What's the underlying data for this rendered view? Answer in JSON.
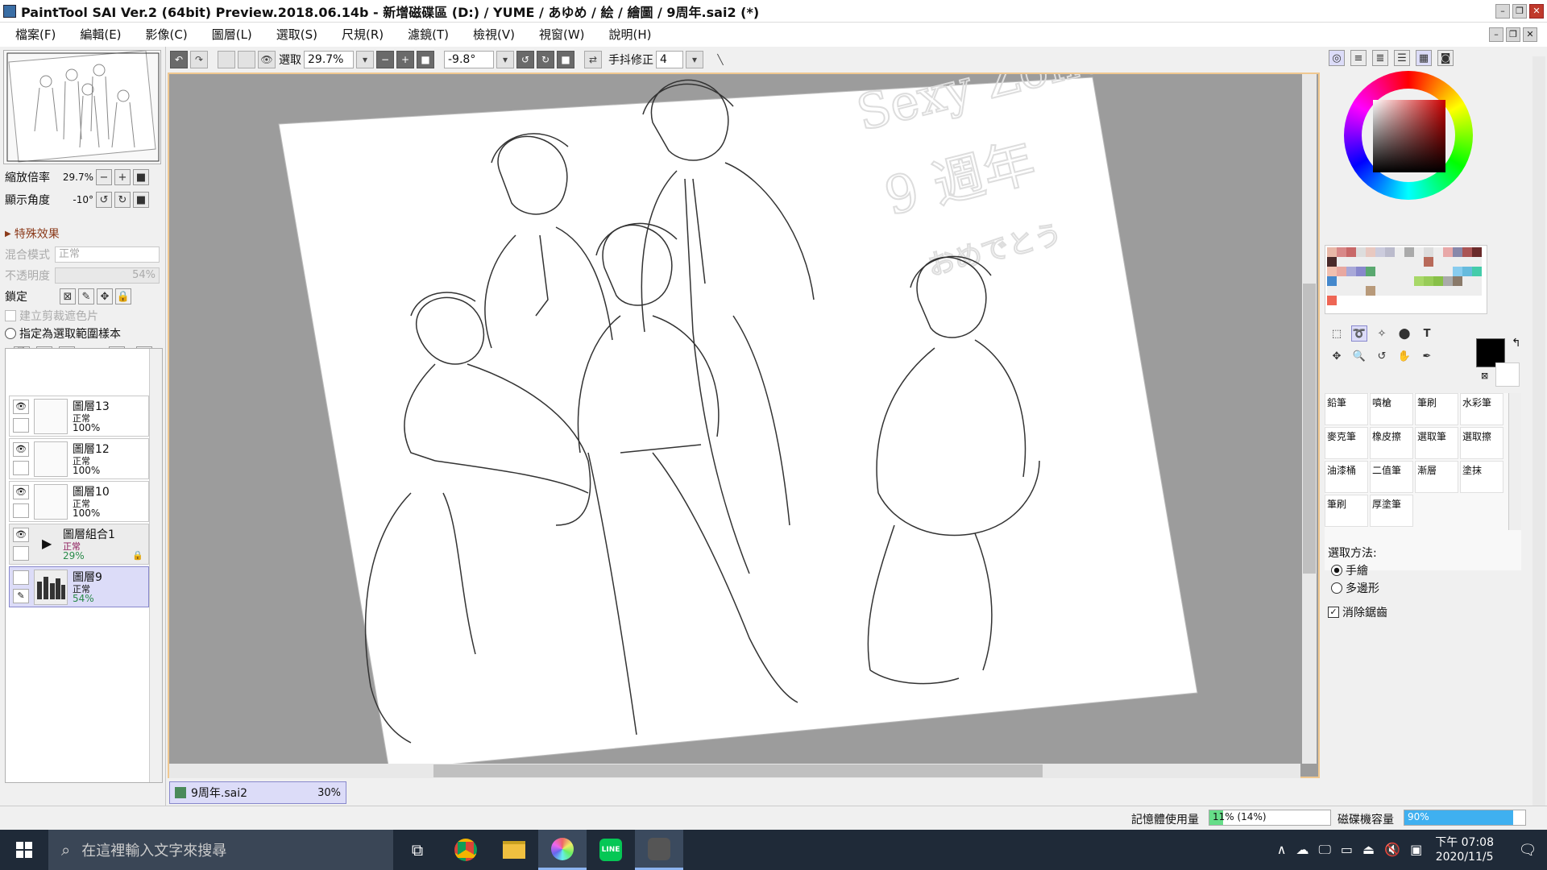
{
  "window": {
    "title": "PaintTool SAI Ver.2 (64bit) Preview.2018.06.14b - 新增磁碟區 (D:) / YUME / あゆめ / 絵 / 繪圖 / 9周年.sai2 (*)"
  },
  "menu": [
    "檔案(F)",
    "編輯(E)",
    "影像(C)",
    "圖層(L)",
    "選取(S)",
    "尺規(R)",
    "濾鏡(T)",
    "檢視(V)",
    "視窗(W)",
    "說明(H)"
  ],
  "toolbar": {
    "select_label": "選取",
    "zoom": "29.7%",
    "angle": "-9.8°",
    "stabilizer_label": "手抖修正",
    "stabilizer_value": "4"
  },
  "navigator": {
    "zoom_label": "縮放倍率",
    "zoom_value": "29.7%",
    "angle_label": "顯示角度",
    "angle_value": "-10°"
  },
  "layer_props": {
    "effects": "特殊效果",
    "blend_label": "混合模式",
    "blend_value": "正常",
    "opacity_label": "不透明度",
    "opacity_value": "54%",
    "lock_label": "鎖定",
    "clip_label": "建立剪裁遮色片",
    "sample_label": "指定為選取範圍樣本"
  },
  "layers": [
    {
      "name": "圖層13",
      "mode": "正常",
      "opacity": "100%"
    },
    {
      "name": "圖層12",
      "mode": "正常",
      "opacity": "100%"
    },
    {
      "name": "圖層10",
      "mode": "正常",
      "opacity": "100%"
    },
    {
      "name": "圖層組合1",
      "mode": "正常",
      "opacity": "29%"
    },
    {
      "name": "圖層9",
      "mode": "正常",
      "opacity": "54%"
    }
  ],
  "canvas": {
    "text_line1": "Sexy Zone",
    "text_line2": "9 週年",
    "text_line3": "おめでとう"
  },
  "doc_tab": {
    "name": "9周年.sai2",
    "zoom": "30%"
  },
  "brushes": [
    {
      "name": "鉛筆"
    },
    {
      "name": "噴槍"
    },
    {
      "name": "筆刷"
    },
    {
      "name": "水彩筆"
    },
    {
      "name": "麥克筆"
    },
    {
      "name": "橡皮擦"
    },
    {
      "name": "選取筆"
    },
    {
      "name": "選取擦"
    },
    {
      "name": "油漆桶"
    },
    {
      "name": "二值筆"
    },
    {
      "name": "漸層"
    },
    {
      "name": "塗抹"
    },
    {
      "name": "筆刷"
    },
    {
      "name": "厚塗筆"
    }
  ],
  "selection": {
    "method_label": "選取方法:",
    "option1": "手繪",
    "option2": "多邊形",
    "antialias": "消除鋸齒"
  },
  "status": {
    "memory_label": "記憶體使用量",
    "memory_value": "11% (14%)",
    "memory_fraction": 0.11,
    "disk_label": "磁碟機容量",
    "disk_value": "90%",
    "disk_fraction": 0.9
  },
  "taskbar": {
    "search_placeholder": "在這裡輸入文字來搜尋",
    "time": "下午 07:08",
    "date": "2020/11/5"
  },
  "colors": {
    "accent": "#8cb4f0",
    "selected_layer": "#dcdcf8",
    "canvas_border": "#f0c890",
    "primary_color": "#000000"
  }
}
